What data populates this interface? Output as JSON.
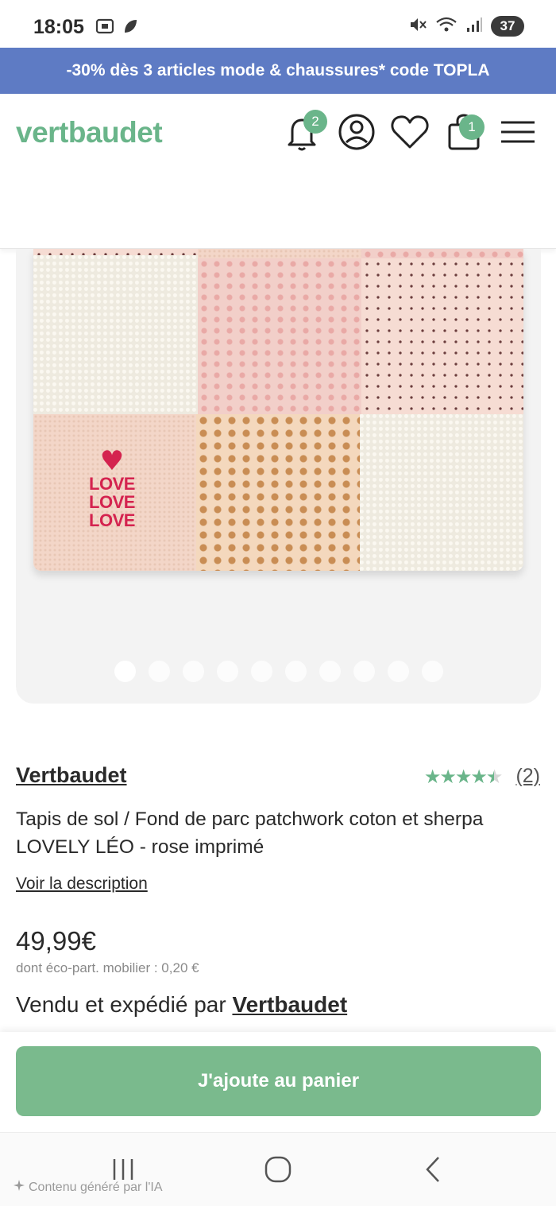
{
  "status_bar": {
    "time": "18:05",
    "battery": "37"
  },
  "promo_banner": {
    "text": "-30% dès 3 articles mode & chaussures* code TOPLA"
  },
  "header": {
    "logo": "vertbaudet",
    "notifications_count": "2",
    "cart_count": "1",
    "icons": [
      "bell-icon",
      "account-icon",
      "heart-icon",
      "bag-icon",
      "menu-icon"
    ]
  },
  "gallery": {
    "image_lettering": [
      "LOVE",
      "LOVE",
      "LOVE"
    ],
    "dot_count": 10,
    "active_dot": 0
  },
  "product": {
    "brand": "Vertbaudet",
    "rating_stars": 4.5,
    "rating_count": "(2)",
    "title_line1": "Tapis de sol / Fond de parc patchwork coton et sherpa",
    "title_line2": "LOVELY LÉO - rose imprimé",
    "description_link": "Voir la description",
    "price": "49,99€",
    "eco_part": "dont éco-part. mobilier : 0,20 €",
    "sold_by_prefix": "Vendu et expédié par",
    "sold_by_seller": "Vertbaudet"
  },
  "cart": {
    "button_label": "J'ajoute au panier"
  },
  "nav_bar": {
    "ai_note": "Contenu généré par l'IA"
  },
  "colors": {
    "brand_green": "#6ab58a",
    "button_green": "#7aba8d",
    "promo_blue": "#5e7bc4"
  }
}
